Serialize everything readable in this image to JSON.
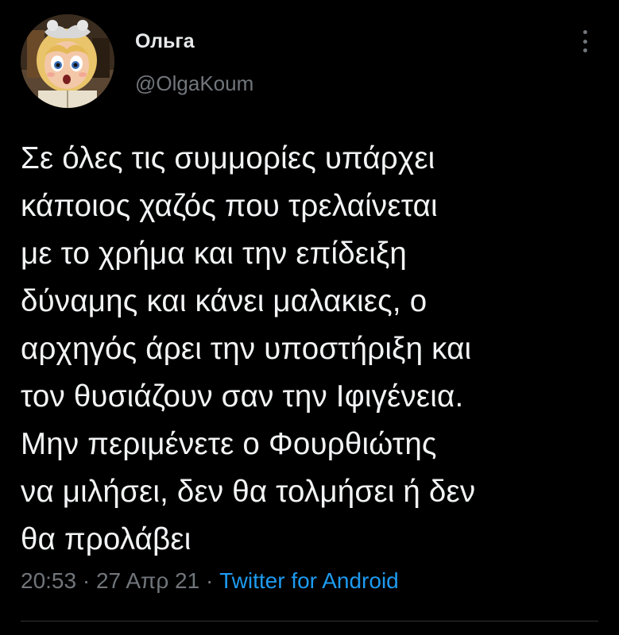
{
  "tweet": {
    "author": {
      "display_name": "Ольга",
      "handle": "@OlgaKoum",
      "avatar_icon": "cartoon-girl-avatar"
    },
    "more_icon": "more-vertical-icon",
    "text_lines": [
      "Σε όλες τις συμμορίες υπάρχει",
      "κάποιος χαζός που τρελαίνεται",
      "με το χρήμα και την επίδειξη",
      "δύναμης και κάνει μαλακιες, ο",
      "αρχηγός άρει την υποστήριξη και",
      "τον θυσιάζουν σαν την Ιφιγένεια.",
      "Μην περιμένετε ο Φουρθιώτης",
      "να μιλήσει, δεν θα τολμήσει ή δεν",
      "θα προλάβει"
    ],
    "time": "20:53",
    "separator": " · ",
    "date": "27 Απρ 21",
    "source": "Twitter for Android"
  },
  "colors": {
    "background": "#000000",
    "text_primary": "#e7e9ea",
    "text_secondary": "#71767b",
    "link": "#1d9bf0",
    "divider": "#2f3336"
  }
}
